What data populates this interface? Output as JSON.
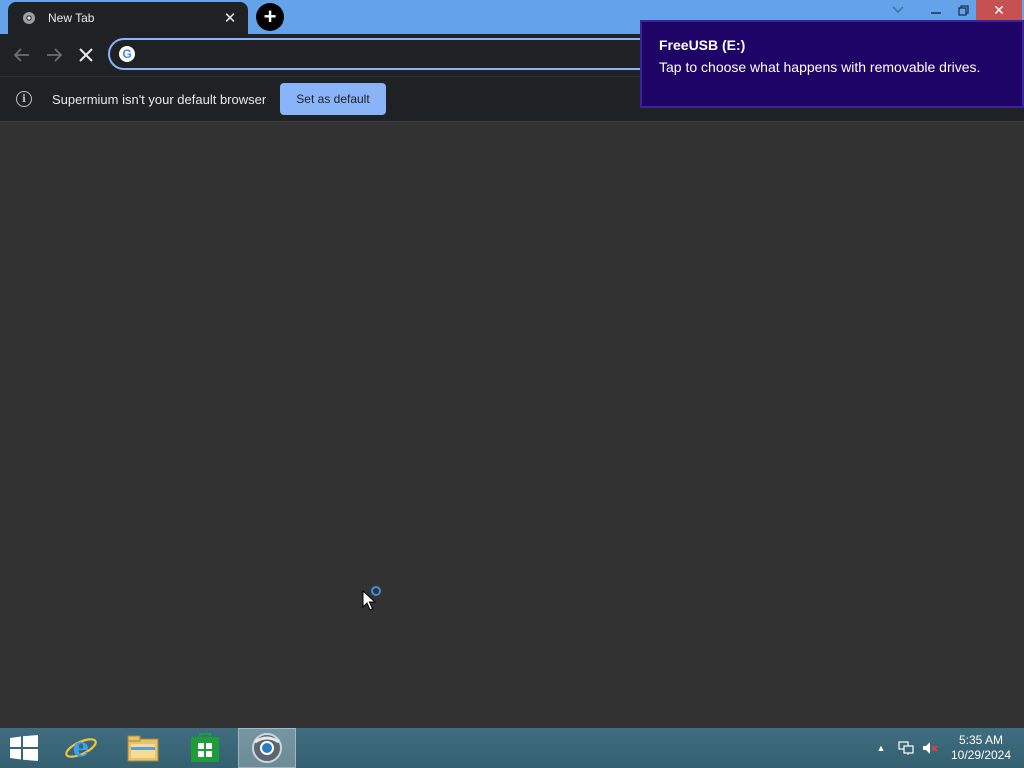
{
  "browser": {
    "tab": {
      "title": "New Tab"
    },
    "omnibox": {
      "value": "",
      "placeholder": ""
    },
    "infobar": {
      "message": "Supermium isn't your default browser",
      "button_label": "Set as default"
    },
    "accent_color": "#8ab4f8"
  },
  "toast": {
    "title": "FreeUSB (E:)",
    "body": "Tap to choose what happens with removable drives.",
    "background": "#1f0468"
  },
  "taskbar": {
    "pinned": [
      "start-button",
      "internet-explorer",
      "file-explorer",
      "store",
      "supermium-browser"
    ],
    "clock": {
      "time": "5:35 AM",
      "date": "10/29/2024"
    }
  }
}
